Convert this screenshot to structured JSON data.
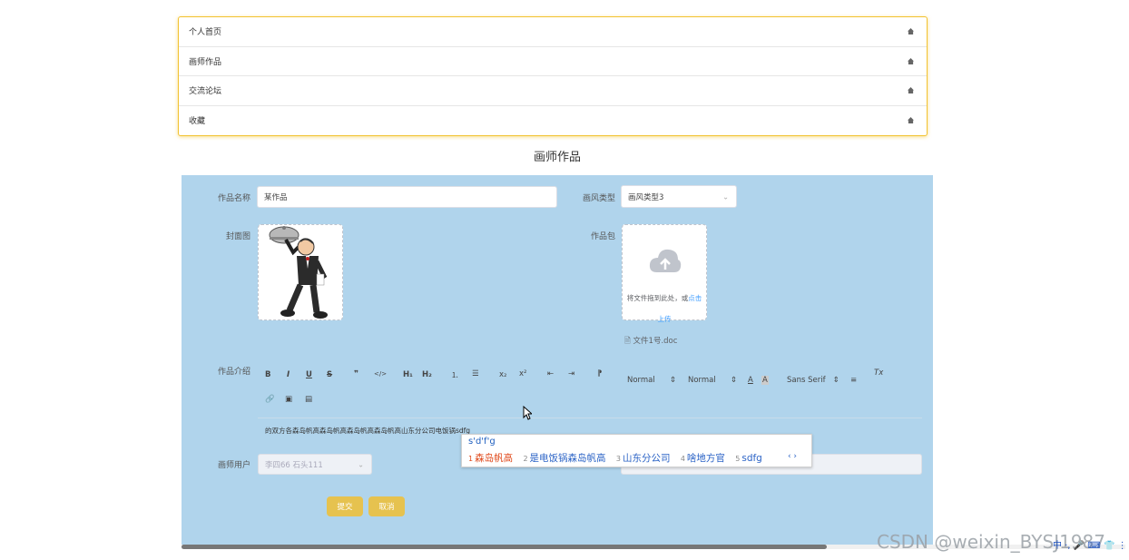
{
  "menu": {
    "items": [
      {
        "label": "个人首页"
      },
      {
        "label": "画师作品"
      },
      {
        "label": "交流论坛"
      },
      {
        "label": "收藏"
      }
    ]
  },
  "page_title": "画师作品",
  "form": {
    "name_label": "作品名称",
    "name_value": "某作品",
    "style_label": "画风类型",
    "style_value": "画风类型3",
    "cover_label": "封面图",
    "package_label": "作品包",
    "upload_text_prefix": "将文件拖到此处，或",
    "upload_text_link": "点击",
    "upload_text_suffix": "上传",
    "file_name": "文件1号.doc",
    "intro_label": "作品介绍",
    "editor_content": "的双方各森岛帆高森岛帆高森岛帆高森岛帆高山东分公司电饭锅sdfg",
    "user_label": "画师用户",
    "user_value": "李四66 石头111",
    "submit_label": "提交",
    "cancel_label": "取消"
  },
  "toolbar": {
    "bold": "B",
    "italic": "I",
    "underline": "U",
    "strike": "S",
    "quote": "❞",
    "code": "</>",
    "h1": "H₁",
    "h2": "H₂",
    "ol": "⒈",
    "ul": "☰",
    "sub": "x₂",
    "sup": "x²",
    "outdent": "⇤",
    "indent": "⇥",
    "rtl": "⁋",
    "size_select": "Normal",
    "header_select": "Normal",
    "font_color": "A",
    "bg_color": "A",
    "font_select": "Sans Serif",
    "align": "≡",
    "clean": "Tx"
  },
  "ime": {
    "composition": "s'd'f'g",
    "candidates": [
      {
        "num": "1",
        "text": "森岛帆高"
      },
      {
        "num": "2",
        "text": "是电饭锅森岛帆高"
      },
      {
        "num": "3",
        "text": "山东分公司"
      },
      {
        "num": "4",
        "text": "啥地方官"
      },
      {
        "num": "5",
        "text": "sdfg"
      }
    ],
    "nav": "‹ ›"
  },
  "watermark": "CSDN @weixin_BYSJ1987",
  "tray": "中 ·, 🎤 ⌨ 👕 ⋮",
  "colors": {
    "form_bg": "#b0d4ec",
    "button": "#e6c24f",
    "menu_border": "#f2c230",
    "link": "#409eff",
    "ime_first": "#e04a1c"
  }
}
